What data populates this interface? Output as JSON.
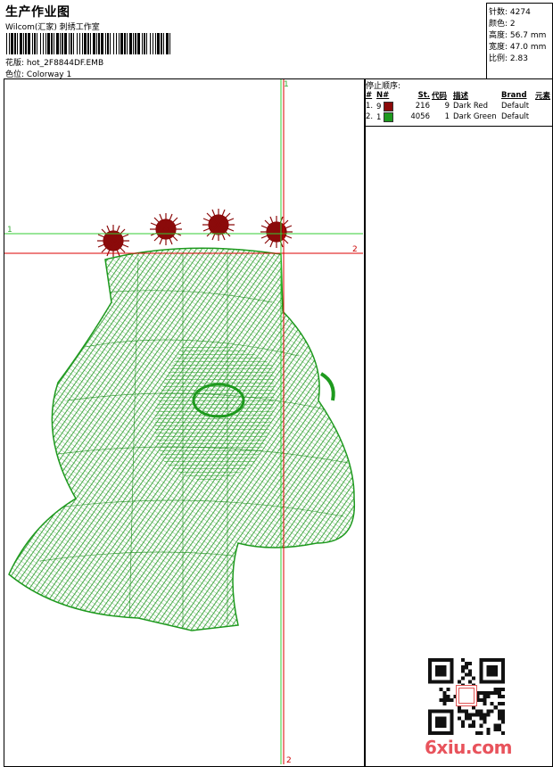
{
  "header": {
    "title": "生产作业图",
    "company": "Wilcom(汇家) 刺绣工作室",
    "design_label": "花版:",
    "design_value": "hot_2F8844DF.EMB",
    "colorway_label": "色位:",
    "colorway_value": "Colorway 1"
  },
  "stats": [
    {
      "label": "针数:",
      "value": "4274"
    },
    {
      "label": "颜色:",
      "value": "2"
    },
    {
      "label": "高度:",
      "value": "56.7 mm"
    },
    {
      "label": "宽度:",
      "value": "47.0 mm"
    },
    {
      "label": "比例:",
      "value": "2.83"
    }
  ],
  "stop_sequence": {
    "title": "停止顺序:",
    "columns": [
      "#",
      "N#",
      "St.",
      "代码",
      "描述",
      "Brand",
      "元素"
    ],
    "rows": [
      {
        "num": "1.",
        "needle": "9",
        "color": "#8b0a0a",
        "stitches": "216",
        "code": "9",
        "desc": "Dark Red",
        "brand": "Default"
      },
      {
        "num": "2.",
        "needle": "1",
        "color": "#1e9a1e",
        "stitches": "4056",
        "code": "1",
        "desc": "Dark Green",
        "brand": "Default"
      }
    ]
  },
  "guides": {
    "h1": "1",
    "h2": "2",
    "v1": "1",
    "v2": "2"
  },
  "watermark": "6xiu.com",
  "colors": {
    "thread_red": "#8b0a0a",
    "thread_green": "#1e9a1e",
    "guide_green": "#33cc33",
    "guide_red": "#dd0000"
  }
}
